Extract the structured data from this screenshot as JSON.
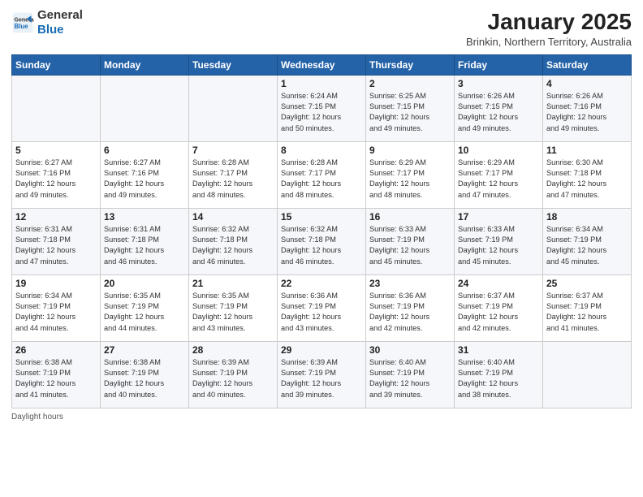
{
  "header": {
    "logo_line1": "General",
    "logo_line2": "Blue",
    "month": "January 2025",
    "location": "Brinkin, Northern Territory, Australia"
  },
  "days_of_week": [
    "Sunday",
    "Monday",
    "Tuesday",
    "Wednesday",
    "Thursday",
    "Friday",
    "Saturday"
  ],
  "footer_label": "Daylight hours",
  "weeks": [
    [
      {
        "day": "",
        "info": ""
      },
      {
        "day": "",
        "info": ""
      },
      {
        "day": "",
        "info": ""
      },
      {
        "day": "1",
        "info": "Sunrise: 6:24 AM\nSunset: 7:15 PM\nDaylight: 12 hours\nand 50 minutes."
      },
      {
        "day": "2",
        "info": "Sunrise: 6:25 AM\nSunset: 7:15 PM\nDaylight: 12 hours\nand 49 minutes."
      },
      {
        "day": "3",
        "info": "Sunrise: 6:26 AM\nSunset: 7:15 PM\nDaylight: 12 hours\nand 49 minutes."
      },
      {
        "day": "4",
        "info": "Sunrise: 6:26 AM\nSunset: 7:16 PM\nDaylight: 12 hours\nand 49 minutes."
      }
    ],
    [
      {
        "day": "5",
        "info": "Sunrise: 6:27 AM\nSunset: 7:16 PM\nDaylight: 12 hours\nand 49 minutes."
      },
      {
        "day": "6",
        "info": "Sunrise: 6:27 AM\nSunset: 7:16 PM\nDaylight: 12 hours\nand 49 minutes."
      },
      {
        "day": "7",
        "info": "Sunrise: 6:28 AM\nSunset: 7:17 PM\nDaylight: 12 hours\nand 48 minutes."
      },
      {
        "day": "8",
        "info": "Sunrise: 6:28 AM\nSunset: 7:17 PM\nDaylight: 12 hours\nand 48 minutes."
      },
      {
        "day": "9",
        "info": "Sunrise: 6:29 AM\nSunset: 7:17 PM\nDaylight: 12 hours\nand 48 minutes."
      },
      {
        "day": "10",
        "info": "Sunrise: 6:29 AM\nSunset: 7:17 PM\nDaylight: 12 hours\nand 47 minutes."
      },
      {
        "day": "11",
        "info": "Sunrise: 6:30 AM\nSunset: 7:18 PM\nDaylight: 12 hours\nand 47 minutes."
      }
    ],
    [
      {
        "day": "12",
        "info": "Sunrise: 6:31 AM\nSunset: 7:18 PM\nDaylight: 12 hours\nand 47 minutes."
      },
      {
        "day": "13",
        "info": "Sunrise: 6:31 AM\nSunset: 7:18 PM\nDaylight: 12 hours\nand 46 minutes."
      },
      {
        "day": "14",
        "info": "Sunrise: 6:32 AM\nSunset: 7:18 PM\nDaylight: 12 hours\nand 46 minutes."
      },
      {
        "day": "15",
        "info": "Sunrise: 6:32 AM\nSunset: 7:18 PM\nDaylight: 12 hours\nand 46 minutes."
      },
      {
        "day": "16",
        "info": "Sunrise: 6:33 AM\nSunset: 7:19 PM\nDaylight: 12 hours\nand 45 minutes."
      },
      {
        "day": "17",
        "info": "Sunrise: 6:33 AM\nSunset: 7:19 PM\nDaylight: 12 hours\nand 45 minutes."
      },
      {
        "day": "18",
        "info": "Sunrise: 6:34 AM\nSunset: 7:19 PM\nDaylight: 12 hours\nand 45 minutes."
      }
    ],
    [
      {
        "day": "19",
        "info": "Sunrise: 6:34 AM\nSunset: 7:19 PM\nDaylight: 12 hours\nand 44 minutes."
      },
      {
        "day": "20",
        "info": "Sunrise: 6:35 AM\nSunset: 7:19 PM\nDaylight: 12 hours\nand 44 minutes."
      },
      {
        "day": "21",
        "info": "Sunrise: 6:35 AM\nSunset: 7:19 PM\nDaylight: 12 hours\nand 43 minutes."
      },
      {
        "day": "22",
        "info": "Sunrise: 6:36 AM\nSunset: 7:19 PM\nDaylight: 12 hours\nand 43 minutes."
      },
      {
        "day": "23",
        "info": "Sunrise: 6:36 AM\nSunset: 7:19 PM\nDaylight: 12 hours\nand 42 minutes."
      },
      {
        "day": "24",
        "info": "Sunrise: 6:37 AM\nSunset: 7:19 PM\nDaylight: 12 hours\nand 42 minutes."
      },
      {
        "day": "25",
        "info": "Sunrise: 6:37 AM\nSunset: 7:19 PM\nDaylight: 12 hours\nand 41 minutes."
      }
    ],
    [
      {
        "day": "26",
        "info": "Sunrise: 6:38 AM\nSunset: 7:19 PM\nDaylight: 12 hours\nand 41 minutes."
      },
      {
        "day": "27",
        "info": "Sunrise: 6:38 AM\nSunset: 7:19 PM\nDaylight: 12 hours\nand 40 minutes."
      },
      {
        "day": "28",
        "info": "Sunrise: 6:39 AM\nSunset: 7:19 PM\nDaylight: 12 hours\nand 40 minutes."
      },
      {
        "day": "29",
        "info": "Sunrise: 6:39 AM\nSunset: 7:19 PM\nDaylight: 12 hours\nand 39 minutes."
      },
      {
        "day": "30",
        "info": "Sunrise: 6:40 AM\nSunset: 7:19 PM\nDaylight: 12 hours\nand 39 minutes."
      },
      {
        "day": "31",
        "info": "Sunrise: 6:40 AM\nSunset: 7:19 PM\nDaylight: 12 hours\nand 38 minutes."
      },
      {
        "day": "",
        "info": ""
      }
    ]
  ]
}
